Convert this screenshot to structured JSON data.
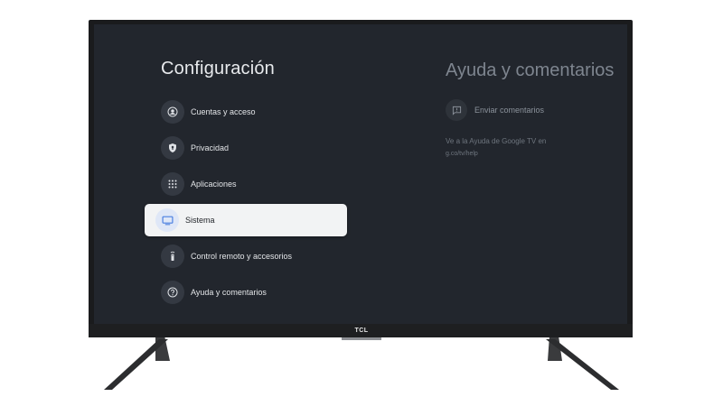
{
  "settings": {
    "title": "Configuración",
    "items": [
      {
        "label": "Cuentas y acceso",
        "icon": "account-circle-icon"
      },
      {
        "label": "Privacidad",
        "icon": "privacy-shield-icon"
      },
      {
        "label": "Aplicaciones",
        "icon": "apps-grid-icon"
      },
      {
        "label": "Sistema",
        "icon": "tv-monitor-icon",
        "selected": true
      },
      {
        "label": "Control remoto y accesorios",
        "icon": "remote-control-icon"
      },
      {
        "label": "Ayuda y comentarios",
        "icon": "help-question-icon"
      }
    ]
  },
  "help_panel": {
    "title": "Ayuda y comentarios",
    "feedback_label": "Enviar comentarios",
    "note": "Ve a la Ayuda de Google TV en",
    "url": "g.co/tv/help"
  },
  "tv": {
    "brand": "TCL"
  },
  "colors": {
    "screen_bg": "#22262d",
    "selected_bg": "#f2f3f4",
    "selected_icon": "#4a7fe0"
  }
}
